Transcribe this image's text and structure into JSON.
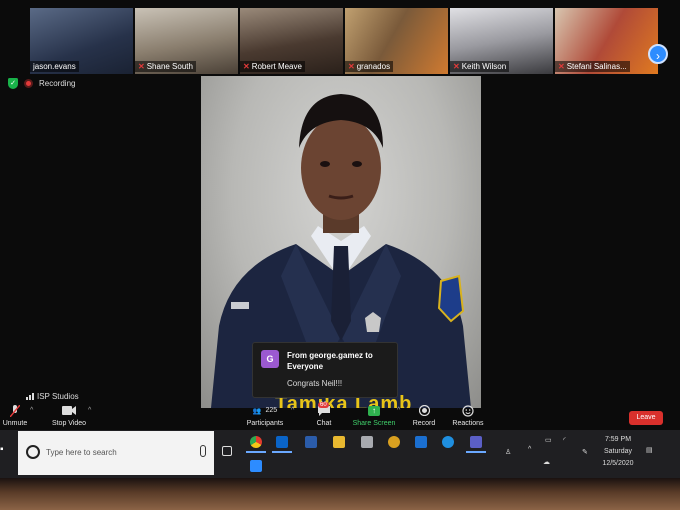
{
  "participants": [
    {
      "name": "jason.evans",
      "muted": false,
      "bg": "#3a4a6a"
    },
    {
      "name": "Shane South",
      "muted": true,
      "bg": "#6b6158"
    },
    {
      "name": "Robert Meave",
      "muted": true,
      "bg": "#4a3a30"
    },
    {
      "name": "granados",
      "muted": true,
      "bg": "#7a5a3a"
    },
    {
      "name": "Keith Wilson",
      "muted": true,
      "bg": "#8a8a90"
    },
    {
      "name": "Stefani Salinas...",
      "muted": true,
      "bg": "#b04a38"
    }
  ],
  "recording_label": "Recording",
  "shared_banner_text": "Tamika Lamb",
  "chat_toast": {
    "avatar_letter": "G",
    "from": "From george.gamez to Everyone",
    "message": "Congrats Neil!!!"
  },
  "active_speaker_label": "ISP Studios",
  "toolbar": {
    "unmute": "Unmute",
    "stop_video": "Stop Video",
    "participants": "Participants",
    "participants_count": "225",
    "chat": "Chat",
    "chat_badge": "60",
    "share_screen": "Share Screen",
    "record": "Record",
    "reactions": "Reactions",
    "leave": "Leave"
  },
  "taskbar": {
    "search_placeholder": "Type here to search",
    "time": "7:59 PM",
    "day": "Saturday",
    "date": "12/5/2020"
  },
  "colors": {
    "accent_blue": "#2d8cff",
    "share_green": "#2fb24f",
    "leave_red": "#d9302c",
    "banner_yellow": "#e8c418"
  }
}
